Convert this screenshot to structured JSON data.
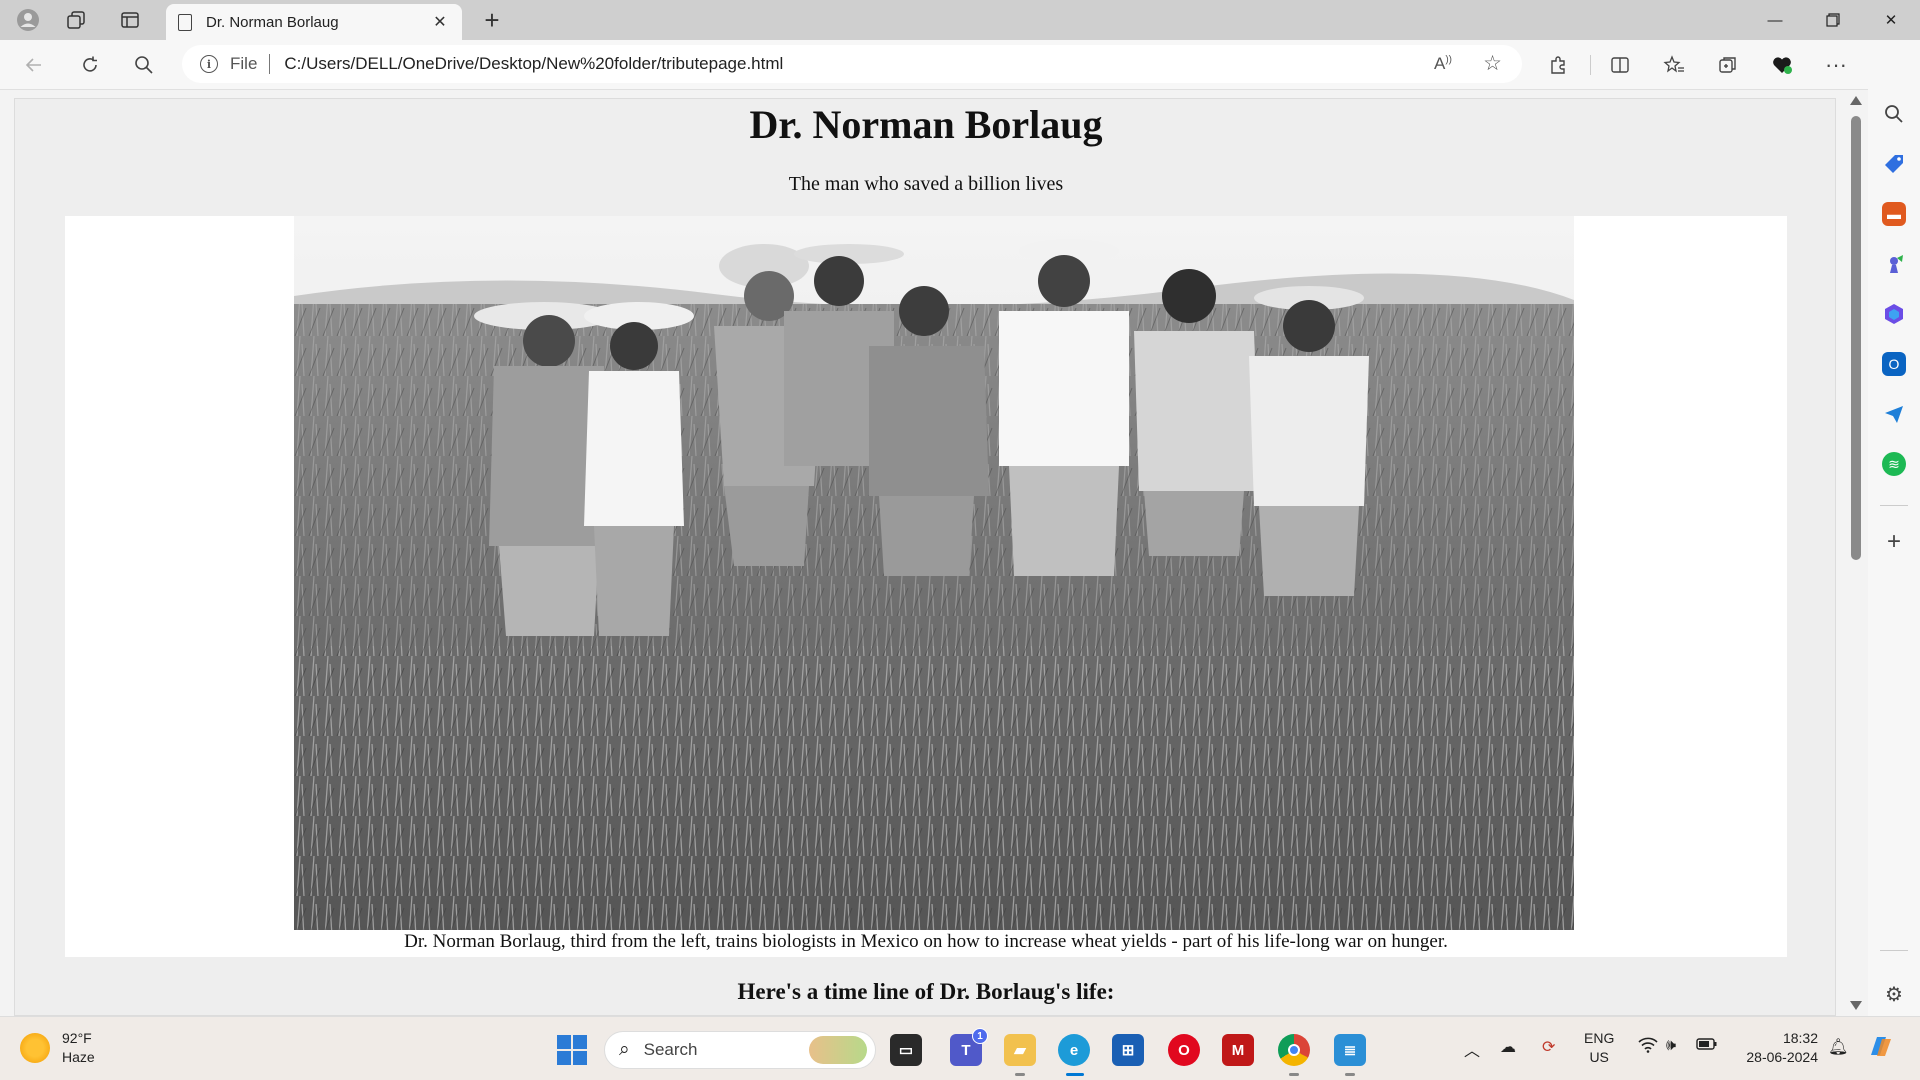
{
  "browser": {
    "tab_title": "Dr. Norman Borlaug",
    "address_label": "File",
    "url": "C:/Users/DELL/OneDrive/Desktop/New%20folder/tributepage.html"
  },
  "page": {
    "title": "Dr. Norman Borlaug",
    "subtitle": "The man who saved a billion lives",
    "caption": "Dr. Norman Borlaug, third from the left, trains biologists in Mexico on how to increase wheat yields - part of his life-long war on hunger.",
    "timeline_heading": "Here's a time line of Dr. Borlaug's life:"
  },
  "taskbar": {
    "weather_temp": "92°F",
    "weather_desc": "Haze",
    "search_label": "Search",
    "teams_badge": "1",
    "lang_top": "ENG",
    "lang_bottom": "US",
    "time": "18:32",
    "date": "28-06-2024"
  },
  "icons": {
    "profile": "profile-icon",
    "workspaces": "workspaces-icon",
    "tab-actions": "tab-actions-icon",
    "back": "back-arrow-icon",
    "refresh": "refresh-icon",
    "search": "search-icon",
    "info": "info-icon",
    "read-aloud": "read-aloud-icon",
    "favorite": "star-icon",
    "extensions": "extensions-icon",
    "split-screen": "split-screen-icon",
    "favorites": "favorites-icon",
    "collections": "collections-icon",
    "browser-essentials": "heart-pulse-icon",
    "more": "more-icon",
    "copilot": "copilot-icon"
  },
  "colors": {
    "page_background": "#eeeeee",
    "image_container": "#ffffff",
    "accent": "#0078d4"
  }
}
